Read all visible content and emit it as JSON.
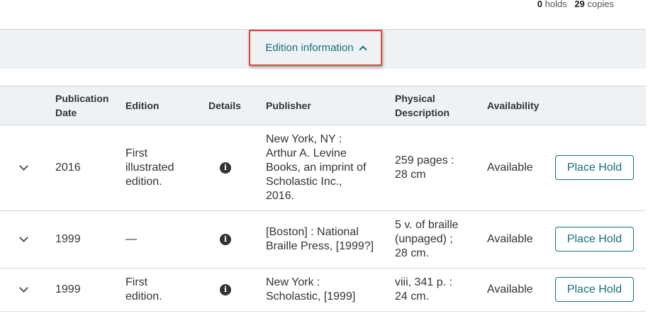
{
  "holds_summary": {
    "holds_count": "0",
    "holds_label": "holds",
    "copies_count": "29",
    "copies_label": "copies"
  },
  "edition_toggle": {
    "label": "Edition information",
    "icon": "chevron-up-icon"
  },
  "table": {
    "headers": {
      "publication_date": [
        "Publication",
        "Date"
      ],
      "edition": "Edition",
      "details": "Details",
      "publisher": "Publisher",
      "physical_description": [
        "Physical",
        "Description"
      ],
      "availability": "Availability"
    },
    "rows": [
      {
        "date": "2016",
        "edition": [
          "First",
          "illustrated",
          "edition."
        ],
        "publisher": [
          "New York, NY :",
          "Arthur A. Levine",
          "Books, an imprint of",
          "Scholastic Inc.,",
          "2016."
        ],
        "physical": [
          "259 pages :",
          "28 cm"
        ],
        "availability": "Available",
        "action": "Place Hold"
      },
      {
        "date": "1999",
        "edition": [
          "—"
        ],
        "publisher": [
          "[Boston] : National",
          "Braille Press, [1999?]"
        ],
        "physical": [
          "5 v. of braille",
          "(unpaged) ;",
          "28 cm."
        ],
        "availability": "Available",
        "action": "Place Hold"
      },
      {
        "date": "1999",
        "edition": [
          "First",
          "edition."
        ],
        "publisher": [
          "New York :",
          "Scholastic, [1999]"
        ],
        "physical": [
          "viii, 341 p. :",
          "24 cm."
        ],
        "availability": "Available",
        "action": "Place Hold"
      }
    ]
  },
  "colors": {
    "accent": "#16707c",
    "highlight_border": "#e0473a",
    "header_bg": "#eef2f5"
  }
}
